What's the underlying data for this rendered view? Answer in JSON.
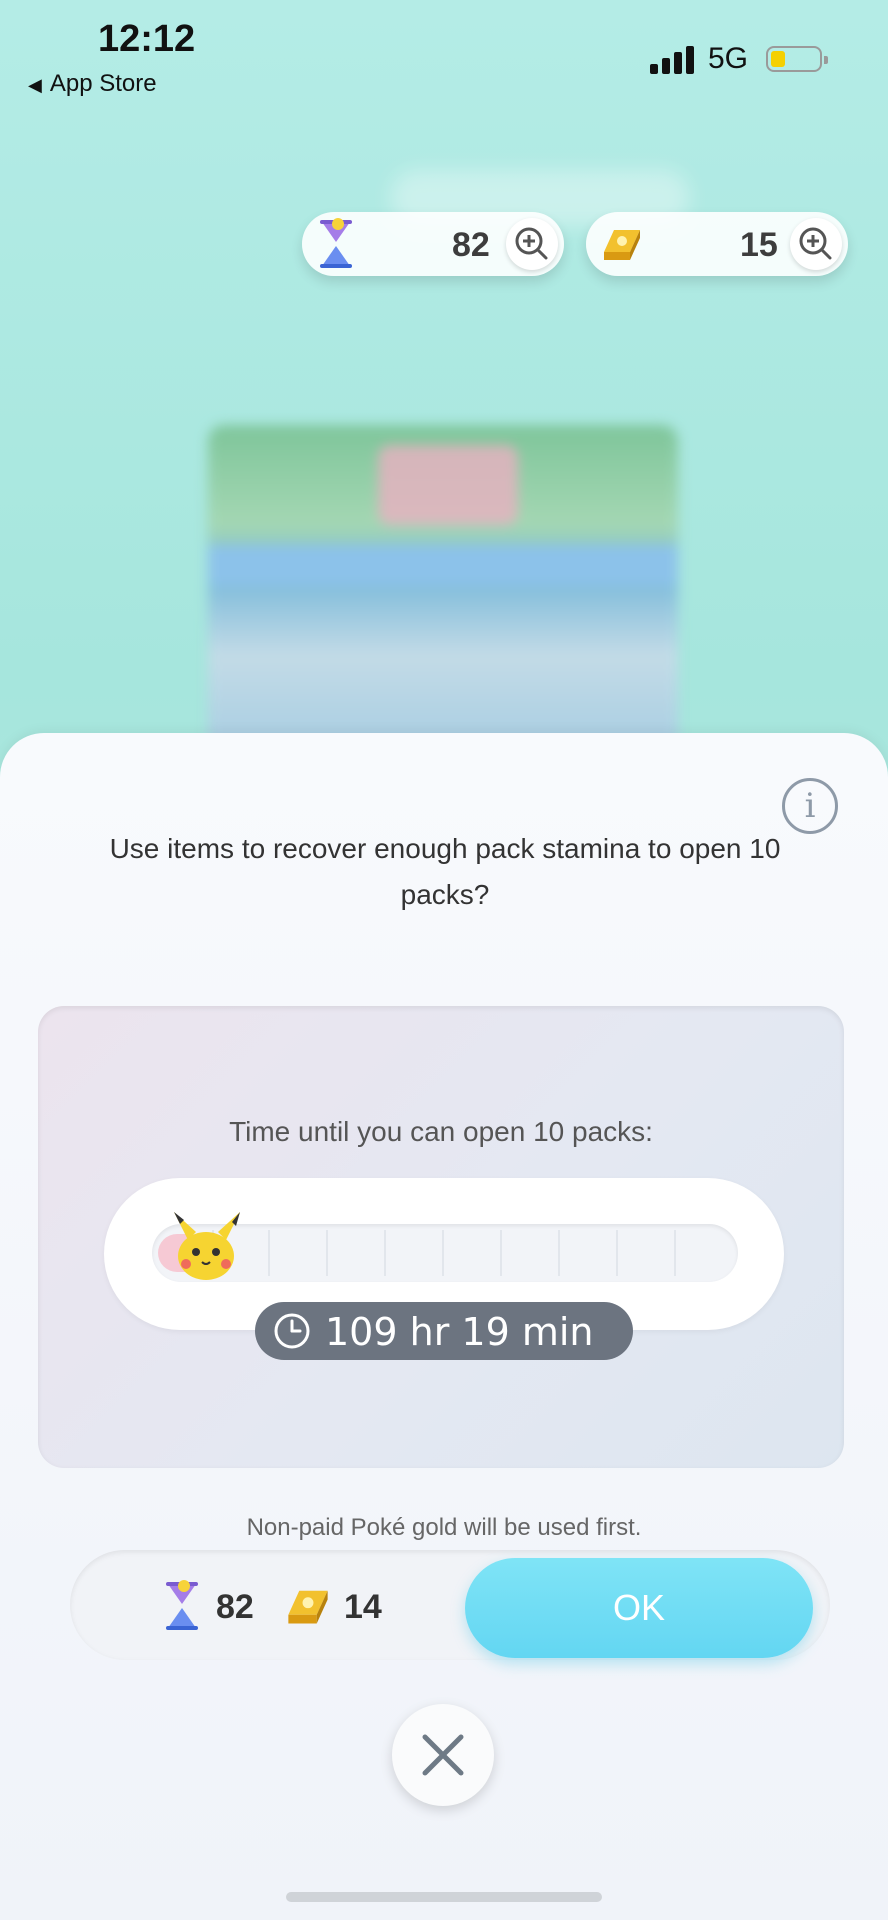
{
  "status_bar": {
    "time": "12:12",
    "back_label": "App Store",
    "network": "5G",
    "battery_level": 0.3
  },
  "currency": {
    "hourglass_count": "82",
    "poke_gold_count": "15"
  },
  "dialog": {
    "prompt": "Use items to recover enough pack stamina to open 10 packs?",
    "timer_label": "Time until you can open 10 packs:",
    "time_remaining": "109 hr 19 min",
    "stamina_progress": 0.05,
    "note": "Non-paid Poké gold will be used first.",
    "cost": {
      "hourglass_count": "82",
      "poke_gold_count": "14"
    },
    "ok_label": "OK"
  },
  "icons": [
    "back-triangle-icon",
    "signal-icon",
    "battery-icon",
    "pack-hourglass-icon",
    "poke-gold-icon",
    "zoom-plus-icon",
    "info-icon",
    "pikachu-icon",
    "clock-icon",
    "close-icon"
  ],
  "colors": {
    "ok_button": "#63d6f2",
    "time_pill": "#6c7480",
    "background": "#a6e6dd"
  }
}
